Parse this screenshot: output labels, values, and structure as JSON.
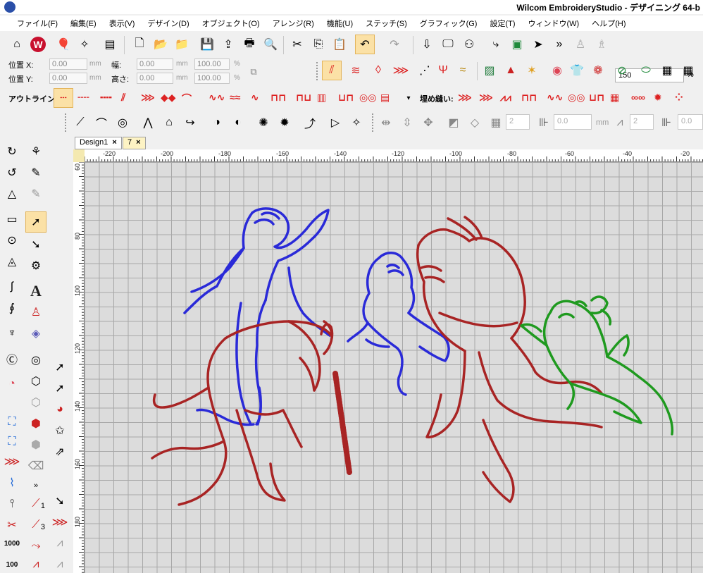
{
  "window": {
    "title": "Wilcom EmbroideryStudio - デザイニング 64-b"
  },
  "menu": [
    "ファイル(F)",
    "編集(E)",
    "表示(V)",
    "デザイン(D)",
    "オブジェクト(O)",
    "アレンジ(R)",
    "機能(U)",
    "ステッチ(S)",
    "グラフィック(G)",
    "設定(T)",
    "ウィンドウ(W)",
    "ヘルプ(H)"
  ],
  "zoom": {
    "value": "150",
    "unit": "%"
  },
  "position": {
    "x_label": "位置 X:",
    "y_label": "位置 Y:",
    "width_label": "幅:",
    "height_label": "高さ:",
    "x_value": "0.00",
    "y_value": "0.00",
    "width_value": "0.00",
    "height_value": "0.00",
    "unit": "mm",
    "w_pct": "100.00",
    "h_pct": "100.00",
    "pct": "%"
  },
  "outline": {
    "label": "アウトライン:",
    "fill_label": "埋め縫い:"
  },
  "spinners": {
    "a": "2",
    "b": "0.0",
    "unit": "mm",
    "c": "2",
    "d": "0.0"
  },
  "tabs": [
    {
      "label": "Design1",
      "close": "×"
    },
    {
      "label": "7",
      "close": "×"
    }
  ],
  "ruler": {
    "top": [
      "-220",
      "-200",
      "-180",
      "-160",
      "-140",
      "-120",
      "-100",
      "-80",
      "-60",
      "-40",
      "-20"
    ],
    "left": [
      "60",
      "80",
      "100",
      "120",
      "140",
      "160",
      "180"
    ]
  },
  "colors": {
    "blue": "#2a2ad8",
    "red": "#a82424",
    "green": "#1f9a1f",
    "accent": "#c8102e"
  },
  "left_tools": {
    "num1": "1",
    "num3": "3",
    "n1000": "1000",
    "n100": "100"
  }
}
